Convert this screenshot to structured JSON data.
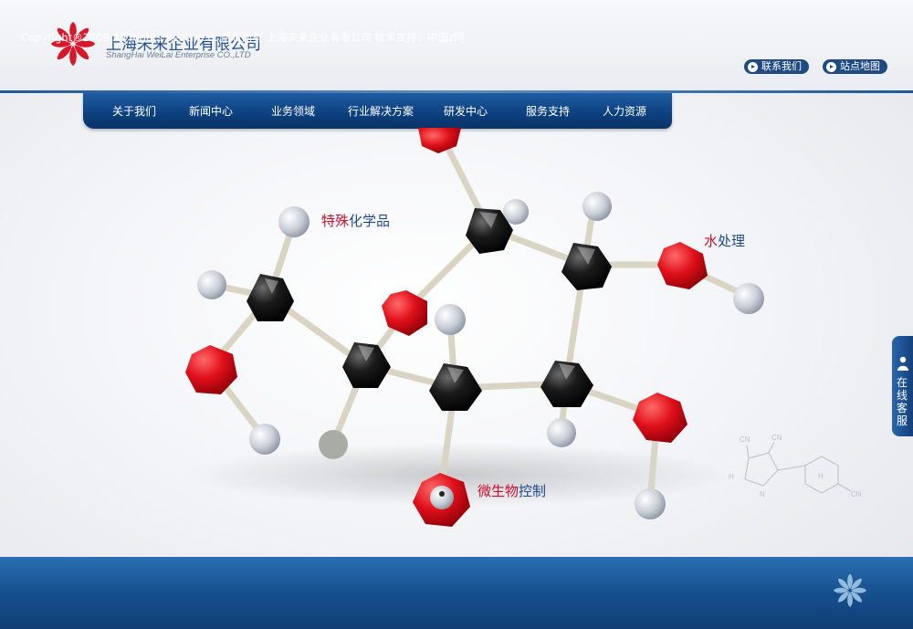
{
  "company": {
    "name_cn": "上海未来企业有限公司",
    "name_en": "ShangHai WeiLai Enterprise CO.,LTD"
  },
  "top_links": [
    {
      "label": "联系我们"
    },
    {
      "label": "站点地图"
    }
  ],
  "nav": {
    "items": [
      {
        "label": "关于我们"
      },
      {
        "label": "新闻中心"
      },
      {
        "label": "业务领域"
      },
      {
        "label": "行业解决方案"
      },
      {
        "label": "研发中心"
      },
      {
        "label": "服务支持"
      },
      {
        "label": "人力资源"
      }
    ]
  },
  "banner": {
    "labels": [
      {
        "red": "特殊",
        "blue": "化学品"
      },
      {
        "red": "水",
        "blue": "处理"
      },
      {
        "red": "微生物",
        "blue": "控制"
      }
    ],
    "chem_labels": [
      "CN",
      "CN",
      "H",
      "N",
      "H",
      "CN"
    ]
  },
  "side_service": {
    "label": "在线客服"
  },
  "footer": {
    "text": "Copyright®2009 All Rights Reserved.   版权所有  上海未来企业有限公司  技术支持：中国z网"
  },
  "colors": {
    "brand_red": "#c8102e",
    "brand_blue": "#1e4a8c",
    "nav_blue": "#0d3f7d",
    "footer_blue": "#16508e"
  },
  "icons": [
    "logo-flower-icon",
    "play-circle-icon",
    "person-icon"
  ]
}
